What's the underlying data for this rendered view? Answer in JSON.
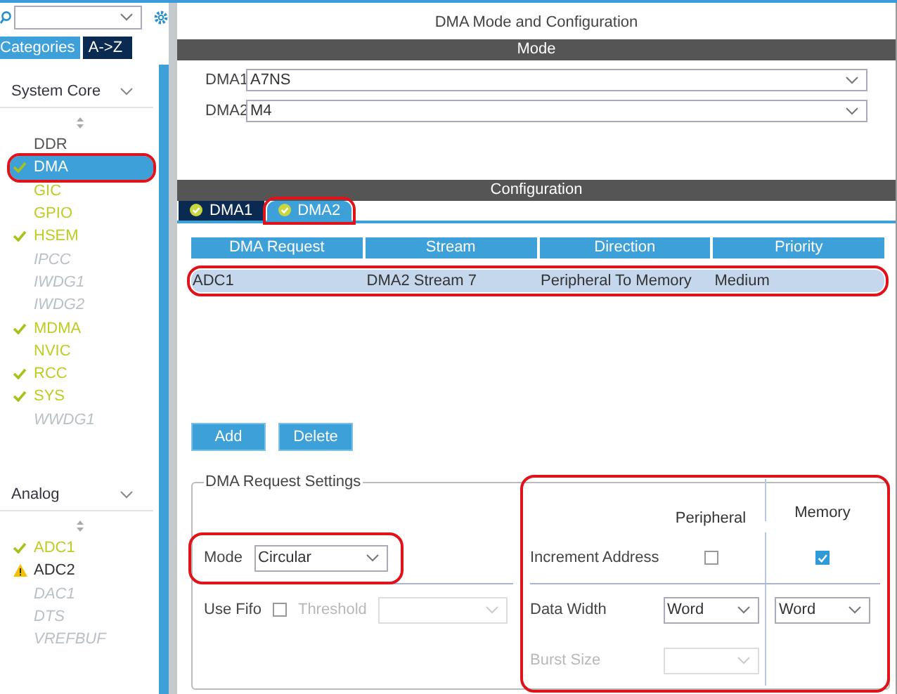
{
  "sidebar": {
    "tabs": [
      {
        "label": "Categories",
        "selected": true
      },
      {
        "label": "A->Z",
        "selected": false
      }
    ],
    "groups": [
      {
        "title": "System Core",
        "items": [
          {
            "label": "DDR",
            "kind": "plain",
            "selected": false,
            "circled": false
          },
          {
            "label": "DMA",
            "kind": "checked",
            "selected": true,
            "circled": true
          },
          {
            "label": "GIC",
            "kind": "ready",
            "selected": false,
            "circled": false
          },
          {
            "label": "GPIO",
            "kind": "ready",
            "selected": false,
            "circled": false
          },
          {
            "label": "HSEM",
            "kind": "checked",
            "selected": false,
            "circled": false
          },
          {
            "label": "IPCC",
            "kind": "disabled",
            "selected": false,
            "circled": false
          },
          {
            "label": "IWDG1",
            "kind": "disabled",
            "selected": false,
            "circled": false
          },
          {
            "label": "IWDG2",
            "kind": "disabled",
            "selected": false,
            "circled": false
          },
          {
            "label": "MDMA",
            "kind": "checked",
            "selected": false,
            "circled": false
          },
          {
            "label": "NVIC",
            "kind": "ready",
            "selected": false,
            "circled": false
          },
          {
            "label": "RCC",
            "kind": "checked",
            "selected": false,
            "circled": false
          },
          {
            "label": "SYS",
            "kind": "checked",
            "selected": false,
            "circled": false
          },
          {
            "label": "WWDG1",
            "kind": "disabled",
            "selected": false,
            "circled": false
          }
        ]
      },
      {
        "title": "Analog",
        "items": [
          {
            "label": "ADC1",
            "kind": "checked",
            "selected": false,
            "circled": false
          },
          {
            "label": "ADC2",
            "kind": "warning",
            "selected": false,
            "circled": false
          },
          {
            "label": "DAC1",
            "kind": "disabled",
            "selected": false,
            "circled": false
          },
          {
            "label": "DTS",
            "kind": "disabled",
            "selected": false,
            "circled": false
          },
          {
            "label": "VREFBUF",
            "kind": "disabled",
            "selected": false,
            "circled": false
          }
        ]
      }
    ]
  },
  "panel": {
    "title": "DMA Mode and Configuration",
    "mode": {
      "title": "Mode",
      "fields": [
        {
          "label": "DMA1",
          "value": "A7NS"
        },
        {
          "label": "DMA2",
          "value": "M4"
        }
      ]
    },
    "configuration": {
      "title": "Configuration",
      "tabs": [
        {
          "label": "DMA1",
          "selected": false,
          "circled": false
        },
        {
          "label": "DMA2",
          "selected": true,
          "circled": true
        }
      ],
      "table": {
        "columns": [
          "DMA Request",
          "Stream",
          "Direction",
          "Priority"
        ],
        "rows": [
          {
            "cells": [
              "ADC1",
              "DMA2 Stream 7",
              "Peripheral To Memory",
              "Medium"
            ],
            "selected": true,
            "circled": true
          }
        ]
      },
      "buttons": [
        "Add",
        "Delete"
      ],
      "settings": {
        "title": "DMA Request Settings",
        "mode": {
          "label": "Mode",
          "value": "Circular",
          "circled": true
        },
        "fifo": {
          "label": "Use Fifo",
          "checked": false,
          "threshold_label": "Threshold",
          "threshold_disabled": true
        },
        "transfer": {
          "circled": true,
          "columns": [
            "Peripheral",
            "Memory"
          ],
          "increment": {
            "label": "Increment Address",
            "peripheral": false,
            "memory": true
          },
          "data_width": {
            "label": "Data Width",
            "peripheral": "Word",
            "memory": "Word"
          },
          "burst_size": {
            "label": "Burst Size",
            "disabled": true
          }
        }
      }
    }
  }
}
